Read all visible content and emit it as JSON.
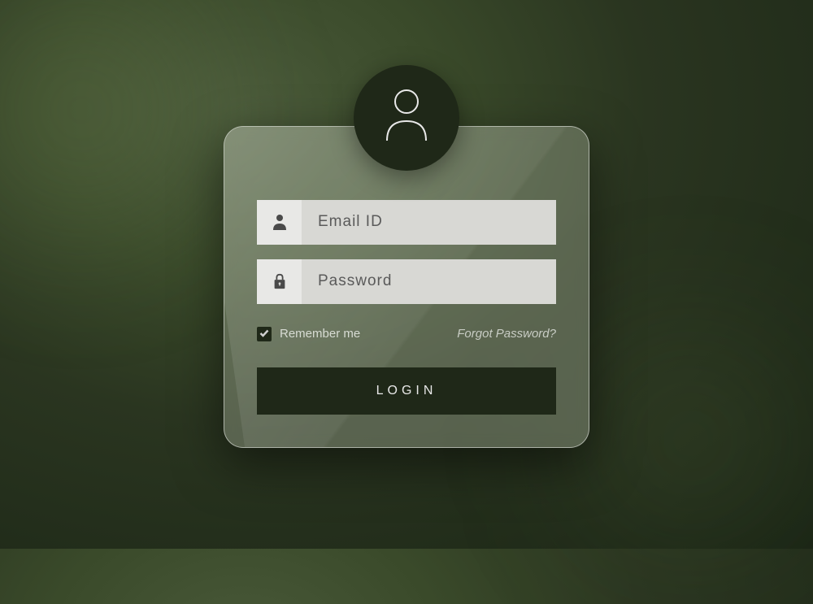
{
  "form": {
    "email": {
      "placeholder": "Email ID",
      "value": ""
    },
    "password": {
      "placeholder": "Password",
      "value": ""
    },
    "remember": {
      "label": "Remember me",
      "checked": true
    },
    "forgot_link": "Forgot Password?",
    "submit_label": "LOGIN"
  },
  "colors": {
    "dark_accent": "#1f2818",
    "input_bg": "#d8d8d4",
    "input_icon_bg": "#e8e8e6"
  }
}
